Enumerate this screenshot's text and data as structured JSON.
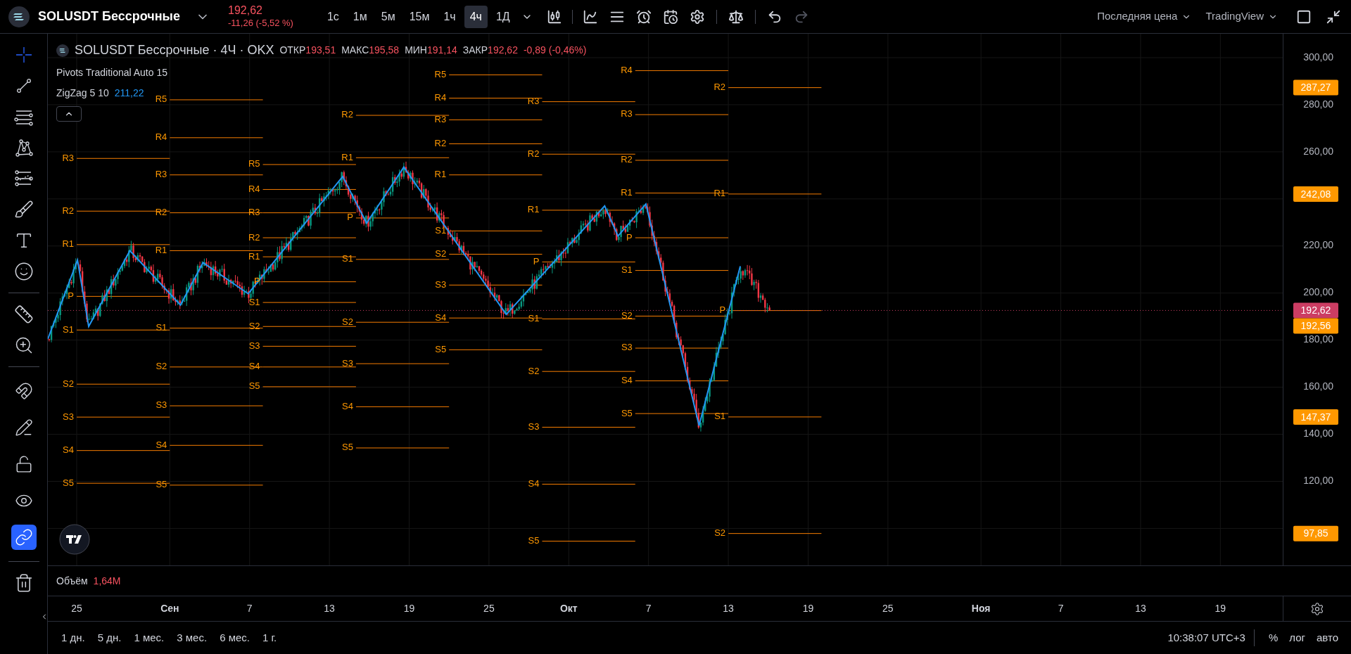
{
  "header": {
    "symbol": "SOLUSDT Бессрочные",
    "price": "192,62",
    "change": "-11,26 (-5,52 %)",
    "intervals": [
      {
        "label": "1с",
        "selected": false
      },
      {
        "label": "1м",
        "selected": false
      },
      {
        "label": "5м",
        "selected": false
      },
      {
        "label": "15м",
        "selected": false
      },
      {
        "label": "1ч",
        "selected": false
      },
      {
        "label": "4ч",
        "selected": true
      },
      {
        "label": "1Д",
        "selected": false
      }
    ],
    "undo": {
      "disabled": false
    },
    "redo": {
      "disabled": true
    },
    "menus": [
      "Последняя цена",
      "TradingView"
    ]
  },
  "toolbar": {
    "drawing_tools": [
      {
        "selected": true
      },
      {
        "selected": false
      },
      {
        "selected": false
      },
      {
        "selected": false
      },
      {
        "selected": false
      },
      {
        "selected": false
      },
      {
        "selected": false
      },
      {
        "selected": false
      }
    ],
    "measure_tools": [
      {
        "selected": false
      },
      {
        "selected": false
      }
    ],
    "toggles": [
      {
        "on": false
      },
      {
        "on": false
      },
      {
        "on": false
      },
      {
        "on": false
      },
      {
        "on": true
      }
    ]
  },
  "chart": {
    "legend": {
      "title": "SOLUSDT Бессрочные · 4Ч · OKX",
      "ohlc": [
        {
          "label": "ОТКР",
          "value": "193,51"
        },
        {
          "label": "МАКС",
          "value": "195,58"
        },
        {
          "label": "МИН",
          "value": "191,14"
        },
        {
          "label": "ЗАКР",
          "value": "192,62"
        }
      ],
      "change": "-0,89 (-0,46%)",
      "indicators": [
        {
          "name": "Pivots Traditional Auto 15"
        },
        {
          "name": "ZigZag 5 10",
          "value": "211,22"
        }
      ]
    },
    "pivots": [
      {
        "levels": [
          "R3",
          "R2",
          "R1",
          "P",
          "S1",
          "S2",
          "S3",
          "S4",
          "S5"
        ]
      },
      {
        "levels": [
          "R5",
          "R4",
          "R3",
          "R2",
          "R1",
          "S1",
          "S2",
          "S3",
          "S4",
          "S5"
        ]
      },
      {
        "levels": [
          "R5",
          "R4",
          "R3",
          "R2",
          "R1",
          "P",
          "S1",
          "S2",
          "S3",
          "S4",
          "S5"
        ]
      },
      {
        "levels": [
          "R2",
          "R1",
          "P",
          "S1",
          "S2",
          "S3",
          "S4",
          "S5"
        ]
      },
      {
        "levels": [
          "R5",
          "R4",
          "R3",
          "R2",
          "R1",
          "S1",
          "S2",
          "S3",
          "S4",
          "S5"
        ]
      },
      {
        "levels": [
          "R3",
          "R2",
          "R1",
          "P",
          "S1",
          "S2",
          "S3",
          "S4",
          "S5"
        ]
      },
      {
        "levels": [
          "R4",
          "R3",
          "R2",
          "R1",
          "P",
          "S1",
          "S2",
          "S3",
          "S4",
          "S5"
        ]
      },
      {
        "levels": [
          "R2",
          "R1",
          "P",
          "S1",
          "S2"
        ]
      }
    ],
    "price_tags": [
      {
        "text": "287,27",
        "color": "#ff9800"
      },
      {
        "text": "242,08",
        "color": "#ff9800"
      },
      {
        "text": "192,62",
        "color": "#cc3d63"
      },
      {
        "text": "192,56",
        "color": "#ff9800"
      },
      {
        "text": "147,37",
        "color": "#ff9800"
      },
      {
        "text": "97,85",
        "color": "#ff9800"
      }
    ],
    "price_axis": [
      "300,00",
      "280,00",
      "260,00",
      "220,00",
      "200,00",
      "180,00",
      "160,00",
      "140,00",
      "120,00"
    ],
    "time_axis": [
      {
        "label": "25",
        "kind": "day"
      },
      {
        "label": "Сен",
        "kind": "month"
      },
      {
        "label": "7",
        "kind": "day"
      },
      {
        "label": "13",
        "kind": "day"
      },
      {
        "label": "19",
        "kind": "day"
      },
      {
        "label": "25",
        "kind": "day"
      },
      {
        "label": "Окт",
        "kind": "month"
      },
      {
        "label": "7",
        "kind": "day"
      },
      {
        "label": "13",
        "kind": "day"
      },
      {
        "label": "19",
        "kind": "day"
      },
      {
        "label": "25",
        "kind": "day"
      },
      {
        "label": "Ноя",
        "kind": "month"
      },
      {
        "label": "7",
        "kind": "day"
      },
      {
        "label": "13",
        "kind": "day"
      },
      {
        "label": "19",
        "kind": "day"
      }
    ],
    "volume": {
      "label": "Объём",
      "value": "1,64M"
    }
  },
  "bottom": {
    "ranges": [
      "1 дн.",
      "5 дн.",
      "1 мес.",
      "3 мес.",
      "6 мес.",
      "1 г."
    ],
    "time": "10:38:07 UTC+3",
    "scale_buttons": [
      "%",
      "лог",
      "авто"
    ]
  }
}
